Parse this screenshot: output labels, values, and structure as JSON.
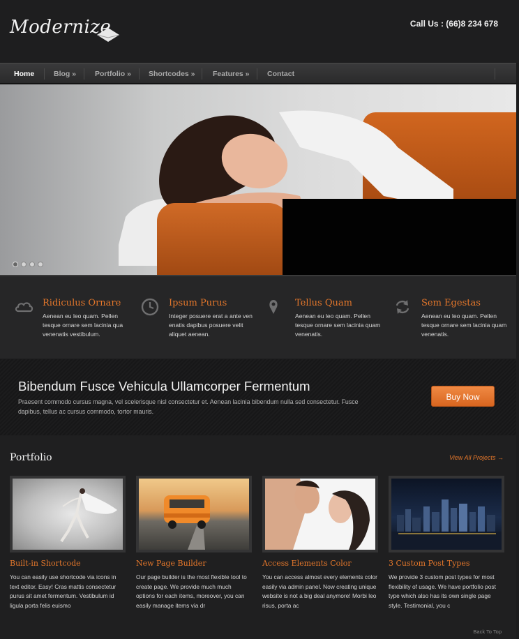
{
  "header": {
    "logo_text": "Modernize",
    "call_us": "Call Us : (66)8 234 678"
  },
  "nav": {
    "items": [
      {
        "label": "Home",
        "active": true
      },
      {
        "label": "Blog »"
      },
      {
        "label": "Portfolio »"
      },
      {
        "label": "Shortcodes »"
      },
      {
        "label": "Features »"
      },
      {
        "label": "Contact"
      }
    ]
  },
  "slider": {
    "slide_count": 4,
    "active_slide": 1
  },
  "features": [
    {
      "icon": "cloud-icon",
      "title": "Ridiculus Ornare",
      "text": "Aenean eu leo quam. Pellen tesque ornare sem lacinia qua venenatis vestibulum."
    },
    {
      "icon": "clock-icon",
      "title": "Ipsum Purus",
      "text": "Integer posuere erat a ante ven enatis dapibus posuere velit aliquet aenean."
    },
    {
      "icon": "map-pin-icon",
      "title": "Tellus Quam",
      "text": "Aenean eu leo quam. Pellen tesque ornare sem lacinia quam venenatis."
    },
    {
      "icon": "refresh-icon",
      "title": "Sem Egestas",
      "text": "Aenean eu leo quam. Pellen tesque ornare sem lacinia quam venenatis."
    }
  ],
  "cta": {
    "title": "Bibendum Fusce Vehicula Ullamcorper Fermentum",
    "text": "Praesent commodo cursus magna, vel scelerisque nisl consectetur et. Aenean lacinia bibendum nulla sed consectetur. Fusce dapibus, tellus ac cursus commodo, tortor mauris.",
    "button": "Buy Now"
  },
  "portfolio": {
    "title": "Portfolio",
    "view_all": "View All Projects →",
    "items": [
      {
        "title": "Built-in Shortcode",
        "text": "You can easily use shortcode via icons in text editor. Easy! Cras mattis consectetur purus sit amet fermentum. Vestibulum id ligula porta felis euismo"
      },
      {
        "title": "New Page Builder",
        "text": "Our page builder is the most flexible tool to create page. We provide much much options for each items,  moreover, you can easily manage items via dr"
      },
      {
        "title": "Access Elements Color",
        "text": "You can access almost every elements color easily via admin panel. Now creating unique website is not a big deal anymore! Morbi leo risus, porta ac"
      },
      {
        "title": "3 Custom Post Types",
        "text": "We provide 3 custom post types for most flexibility of usage. We have portfolio post type which also has its own single page style. Testimonial, you c"
      }
    ]
  },
  "footer": {
    "back_to_top": "Back To Top"
  },
  "colors": {
    "accent": "#e4772b",
    "background": "#1c1c1d",
    "nav_bg": "#333334"
  }
}
